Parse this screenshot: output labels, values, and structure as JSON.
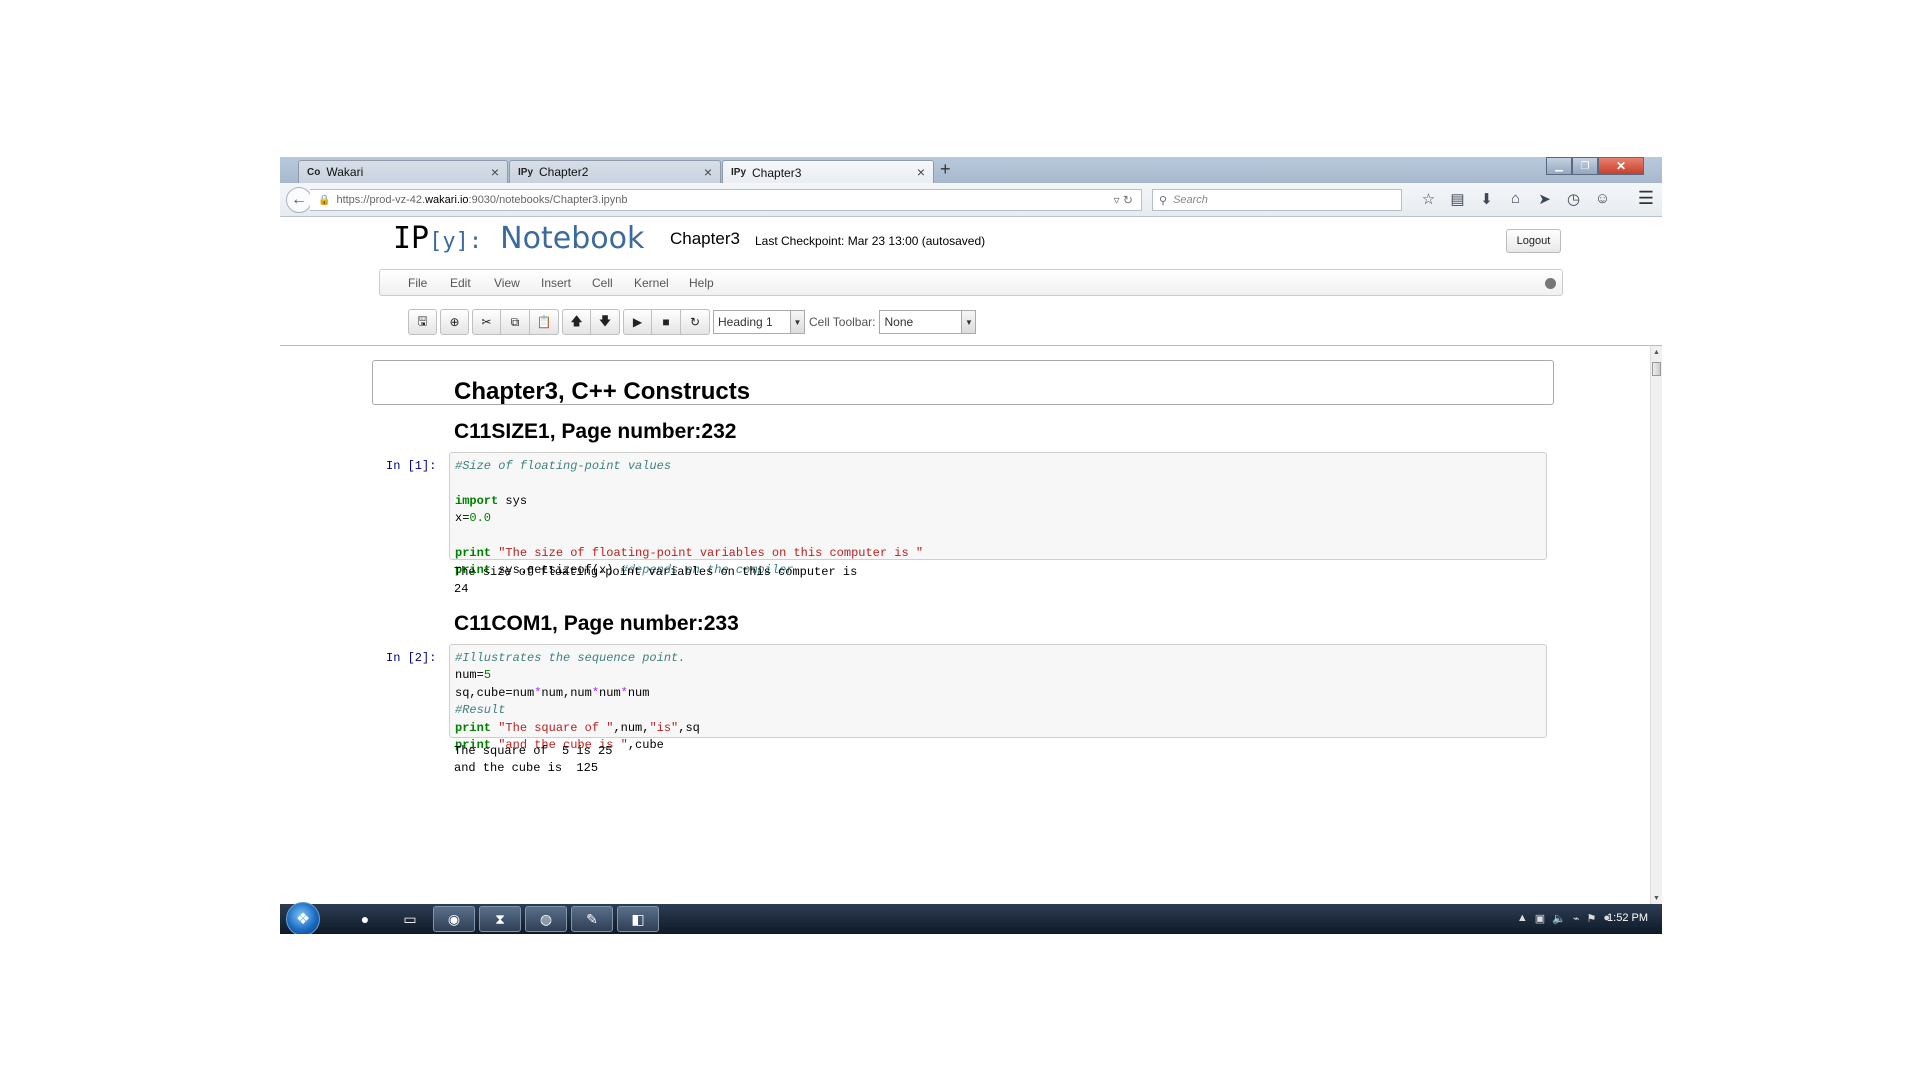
{
  "browser": {
    "tabs": [
      {
        "favicon": "Co",
        "label": "Wakari"
      },
      {
        "favicon": "IPy",
        "label": "Chapter2"
      },
      {
        "favicon": "IPy",
        "label": "Chapter3"
      }
    ],
    "active_tab": 2,
    "new_tab_symbol": "+",
    "url_prefix": "https://prod-vz-42.",
    "url_host": "wakari.io",
    "url_rest": ":9030/notebooks/Chapter3.ipynb",
    "search_placeholder": "Search"
  },
  "ipython": {
    "logo_ip": "IP",
    "logo_y": "[y]:",
    "logo_notebook": "Notebook",
    "notebook_name": "Chapter3",
    "checkpoint": "Last Checkpoint: Mar 23 13:00 (autosaved)",
    "logout_label": "Logout",
    "menu": [
      "File",
      "Edit",
      "View",
      "Insert",
      "Cell",
      "Kernel",
      "Help"
    ],
    "cell_type_value": "Heading 1",
    "cell_toolbar_label": "Cell Toolbar:",
    "cell_toolbar_value": "None"
  },
  "notebook": {
    "title_heading": "Chapter3, C++ Constructs",
    "section1": {
      "heading": "C11SIZE1, Page number:232",
      "prompt": "In [1]:",
      "code_comment": "#Size of floating-point values",
      "code_import_kw": "import",
      "code_import_mod": " sys",
      "code_x_lhs": "x=",
      "code_x_val": "0.0",
      "code_print1_kw": "print",
      "code_print1_str": "\"The size of floating-point variables on this computer is \"",
      "code_print2_kw": "print",
      "code_print2_expr": " sys.getsizeof(x) ",
      "code_print2_comment": "#depends on the compiler",
      "output": "The size of floating-point variables on this computer is \n24"
    },
    "section2": {
      "heading": "C11COM1, Page number:233",
      "prompt": "In [2]:",
      "code_comment1": "#Illustrates the sequence point.",
      "code_num_lhs": "num=",
      "code_num_val": "5",
      "code_sq_a": "sq,cube=num",
      "code_sq_op1": "*",
      "code_sq_b": "num,num",
      "code_sq_op2": "*",
      "code_sq_c": "num",
      "code_sq_op3": "*",
      "code_sq_d": "num",
      "code_comment2": "#Result",
      "code_p1_kw": "print",
      "code_p1_s1": "\"The square of \"",
      "code_p1_mid": ",num,",
      "code_p1_s2": "\"is\"",
      "code_p1_end": ",sq",
      "code_p2_kw": "print",
      "code_p2_s": "\"and the cube is \"",
      "code_p2_end": ",cube",
      "output": "The square of  5 is 25\nand the cube is  125"
    }
  },
  "taskbar": {
    "clock": "1:52 PM"
  }
}
